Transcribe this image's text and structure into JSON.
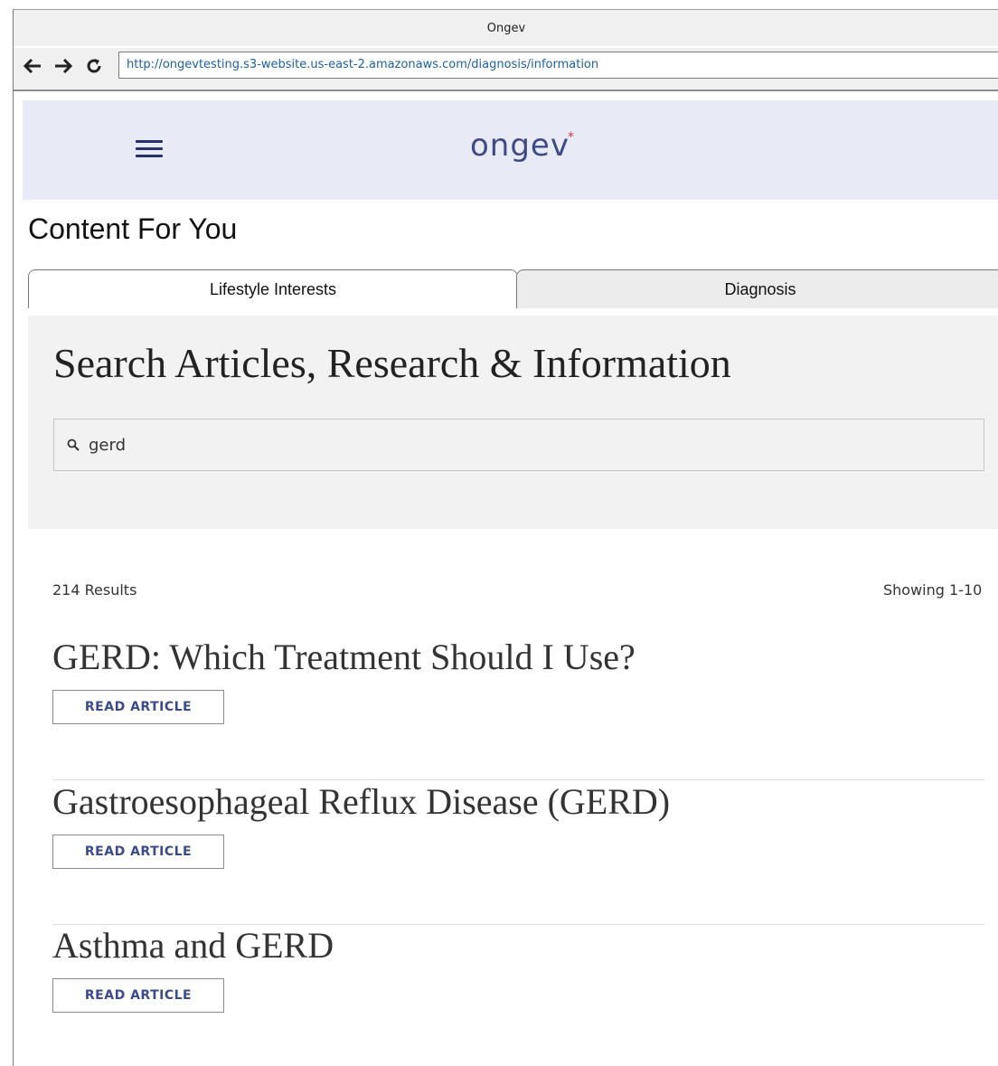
{
  "window": {
    "title": "Ongev"
  },
  "browser": {
    "url": "http://ongevtesting.s3-website.us-east-2.amazonaws.com/diagnosis/information",
    "back_icon": "arrow-left-icon",
    "forward_icon": "arrow-right-icon",
    "reload_icon": "reload-icon"
  },
  "header": {
    "logo_text": "ongev",
    "logo_mark": "*",
    "menu_icon": "hamburger-menu-icon"
  },
  "page": {
    "heading": "Content For You"
  },
  "tabs": [
    {
      "label": "Lifestyle Interests",
      "active": true
    },
    {
      "label": "Diagnosis",
      "active": false
    }
  ],
  "search": {
    "title": "Search Articles, Research & Information",
    "query": "gerd",
    "icon": "search-icon"
  },
  "results": {
    "count_text": "214 Results",
    "range_text": "Showing 1-10",
    "items": [
      {
        "title": "GERD: Which Treatment Should I Use?",
        "button": "READ ARTICLE"
      },
      {
        "title": "Gastroesophageal Reflux Disease (GERD)",
        "button": "READ ARTICLE"
      },
      {
        "title": "Asthma and GERD",
        "button": "READ ARTICLE"
      }
    ]
  },
  "colors": {
    "header_bg": "#e8ebf5",
    "brand": "#3d4a86",
    "logo_accent": "#d9354a",
    "url_text": "#1d5fa6",
    "panel_bg": "#f2f2f2"
  }
}
